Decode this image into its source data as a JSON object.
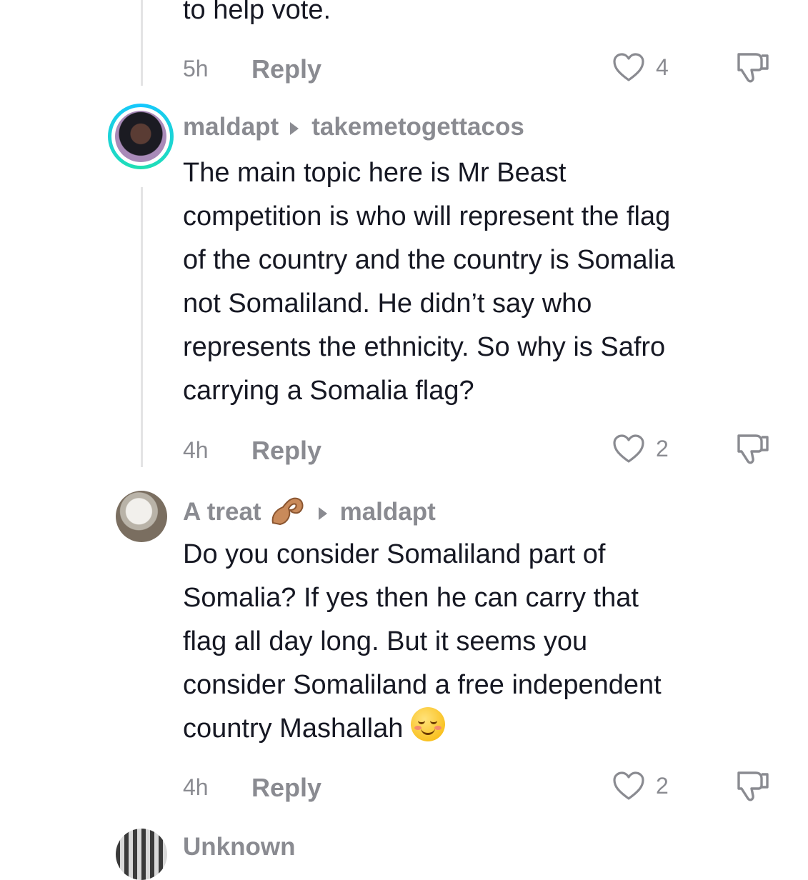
{
  "comments": [
    {
      "text_tail": "to help vote.",
      "time": "5h",
      "reply_label": "Reply",
      "likes": "4"
    },
    {
      "username": "maldapt",
      "reply_to": "takemetogettacos",
      "text": "The main topic here is Mr Beast\ncompetition is who will represent the flag\nof the country and the country is Somalia\nnot Somaliland. He didn’t say who\nrepresents the ethnicity. So why is Safro\ncarrying a Somalia flag?",
      "time": "4h",
      "reply_label": "Reply",
      "likes": "2"
    },
    {
      "username": "A treat",
      "reply_to": "maldapt",
      "text": "Do you consider Somaliland part of\nSomalia? If yes then he can carry that\nflag all day long. But it seems you\nconsider Somaliland a free independent\ncountry Mashallah",
      "time": "4h",
      "reply_label": "Reply",
      "likes": "2"
    },
    {
      "username": "Unknown"
    }
  ],
  "icons": {
    "like": "heart-outline-icon",
    "dislike": "thumbs-down-icon",
    "reply_arrow": "caret-right-icon",
    "emoji_smile": "smiling-blush-emoji",
    "emoji_hand": "pinching-hand-emoji"
  },
  "colors": {
    "text": "#161823",
    "secondary": "#8a8b91",
    "thread_line": "#e3e3e4",
    "story_ring_start": "#16c7ff",
    "story_ring_end": "#20e0b0"
  }
}
